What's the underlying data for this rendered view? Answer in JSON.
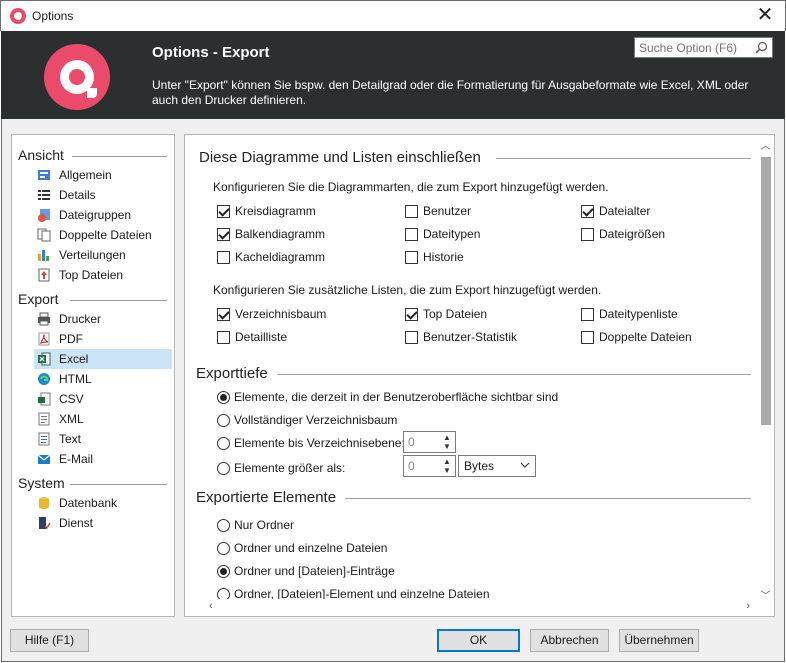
{
  "window": {
    "title": "Options",
    "close_glyph": "✕"
  },
  "header": {
    "title": "Options - Export",
    "description": "Unter \"Export\" können Sie bspw. den Detailgrad oder die Formatierung für Ausgabeformate wie Excel, XML oder auch den Drucker definieren.",
    "search_placeholder": "Suche Option (F6)",
    "brand_color": "#ec4a6a"
  },
  "sidebar": {
    "groups": [
      {
        "label": "Ansicht",
        "items": [
          {
            "label": "Allgemein",
            "icon": "general-icon"
          },
          {
            "label": "Details",
            "icon": "details-icon"
          },
          {
            "label": "Dateigruppen",
            "icon": "filegroups-icon"
          },
          {
            "label": "Doppelte Dateien",
            "icon": "duplicate-files-icon"
          },
          {
            "label": "Verteilungen",
            "icon": "distribution-chart-icon"
          },
          {
            "label": "Top Dateien",
            "icon": "top-files-icon"
          }
        ]
      },
      {
        "label": "Export",
        "items": [
          {
            "label": "Drucker",
            "icon": "printer-icon"
          },
          {
            "label": "PDF",
            "icon": "pdf-icon"
          },
          {
            "label": "Excel",
            "icon": "excel-icon",
            "selected": true
          },
          {
            "label": "HTML",
            "icon": "html-icon"
          },
          {
            "label": "CSV",
            "icon": "csv-icon"
          },
          {
            "label": "XML",
            "icon": "xml-icon"
          },
          {
            "label": "Text",
            "icon": "text-icon"
          },
          {
            "label": "E-Mail",
            "icon": "email-icon"
          }
        ]
      },
      {
        "label": "System",
        "items": [
          {
            "label": "Datenbank",
            "icon": "database-icon"
          },
          {
            "label": "Dienst",
            "icon": "service-icon"
          }
        ]
      }
    ]
  },
  "content": {
    "section1": {
      "title": "Diese Diagramme und Listen einschließen",
      "charts_desc": "Konfigurieren Sie die Diagrammarten, die zum Export hinzugefügt werden.",
      "charts": [
        {
          "label": "Kreisdiagramm",
          "checked": true
        },
        {
          "label": "Benutzer",
          "checked": false
        },
        {
          "label": "Dateialter",
          "checked": true
        },
        {
          "label": "Balkendiagramm",
          "checked": true
        },
        {
          "label": "Dateitypen",
          "checked": false
        },
        {
          "label": "Dateigrößen",
          "checked": false
        },
        {
          "label": "Kacheldiagramm",
          "checked": false
        },
        {
          "label": "Historie",
          "checked": false
        }
      ],
      "lists_desc": "Konfigurieren Sie zusätzliche Listen, die zum Export hinzugefügt werden.",
      "lists": [
        {
          "label": "Verzeichnisbaum",
          "checked": true
        },
        {
          "label": "Top Dateien",
          "checked": true
        },
        {
          "label": "Dateitypenliste",
          "checked": false
        },
        {
          "label": "Detailliste",
          "checked": false
        },
        {
          "label": "Benutzer-Statistik",
          "checked": false
        },
        {
          "label": "Doppelte Dateien",
          "checked": false
        }
      ]
    },
    "section2": {
      "title": "Exporttiefe",
      "options": [
        {
          "label": "Elemente, die derzeit in der Benutzeroberfläche sichtbar sind",
          "selected": true
        },
        {
          "label": "Vollständiger Verzeichnisbaum",
          "selected": false
        },
        {
          "label": "Elemente bis Verzeichnisebene:",
          "selected": false
        },
        {
          "label": "Elemente größer als:",
          "selected": false
        }
      ],
      "level_value": "0",
      "size_value": "0",
      "size_unit": "Bytes"
    },
    "section3": {
      "title": "Exportierte Elemente",
      "options": [
        {
          "label": "Nur Ordner",
          "selected": false
        },
        {
          "label": "Ordner und einzelne Dateien",
          "selected": false
        },
        {
          "label": "Ordner und [Dateien]-Einträge",
          "selected": true
        },
        {
          "label": "Ordner, [Dateien]-Element und einzelne Dateien",
          "selected": false
        }
      ]
    }
  },
  "footer": {
    "help": "Hilfe (F1)",
    "ok": "OK",
    "cancel": "Abbrechen",
    "apply": "Übernehmen"
  }
}
